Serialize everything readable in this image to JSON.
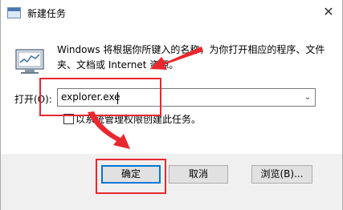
{
  "window": {
    "title": "新建任务",
    "close_glyph": "✕"
  },
  "dialog": {
    "description": "Windows 将根据你所键入的名称，为你打开相应的程序、文件夹、文档或 Internet 资源。",
    "run_label": "打开(O):",
    "run_value": "explorer.exe",
    "dropdown_glyph": "⌄",
    "admin_checkbox_label": "以系统管理权限创建此任务。",
    "admin_checked": false
  },
  "buttons": {
    "ok": "确定",
    "cancel": "取消",
    "browse": "浏览(B)..."
  },
  "icons": {
    "app": "task-manager-icon",
    "run": "run-program-icon",
    "shield": "admin-shield-icon"
  },
  "colors": {
    "annotation": "#e8282e",
    "focus": "#0078d7",
    "footer_bg": "#f0f0f0"
  }
}
